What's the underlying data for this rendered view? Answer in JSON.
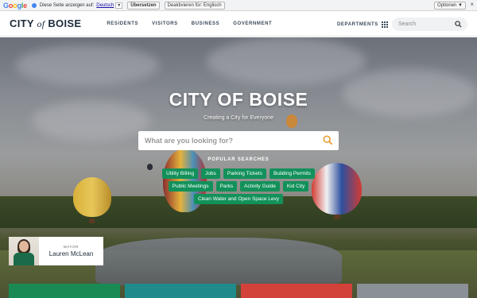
{
  "translate_bar": {
    "logo": "Google",
    "message": "Diese Seite anzeigen auf:",
    "language": "Deutsch",
    "translate_button": "Übersetzen",
    "disable_button": "Deaktivieren für: Englisch",
    "options_button": "Optionen ▼",
    "close": "×"
  },
  "header": {
    "logo_city": "CITY",
    "logo_of": "of",
    "logo_boise": "BOISE",
    "nav": [
      "RESIDENTS",
      "VISITORS",
      "BUSINESS",
      "GOVERNMENT"
    ],
    "departments": "DEPARTMENTS",
    "search_placeholder": "Search"
  },
  "hero": {
    "title": "CITY OF BOISE",
    "subtitle": "Creating a City for Everyone",
    "search_placeholder": "What are you looking for?",
    "popular_title": "POPULAR SEARCHES",
    "popular": [
      "Utility Billing",
      "Jobs",
      "Parking Tickets",
      "Building Permits",
      "Public Meetings",
      "Parks",
      "Activity Guide",
      "Kid City",
      "Clean Water and Open Space Levy"
    ]
  },
  "mayor": {
    "role": "MAYOR",
    "name": "Lauren McLean"
  },
  "colors": {
    "chip_green": "#12915a",
    "tile_green": "#1a8a55",
    "tile_teal": "#1f8b8b",
    "tile_red": "#d2423a",
    "tile_gray": "#8b8f96"
  }
}
